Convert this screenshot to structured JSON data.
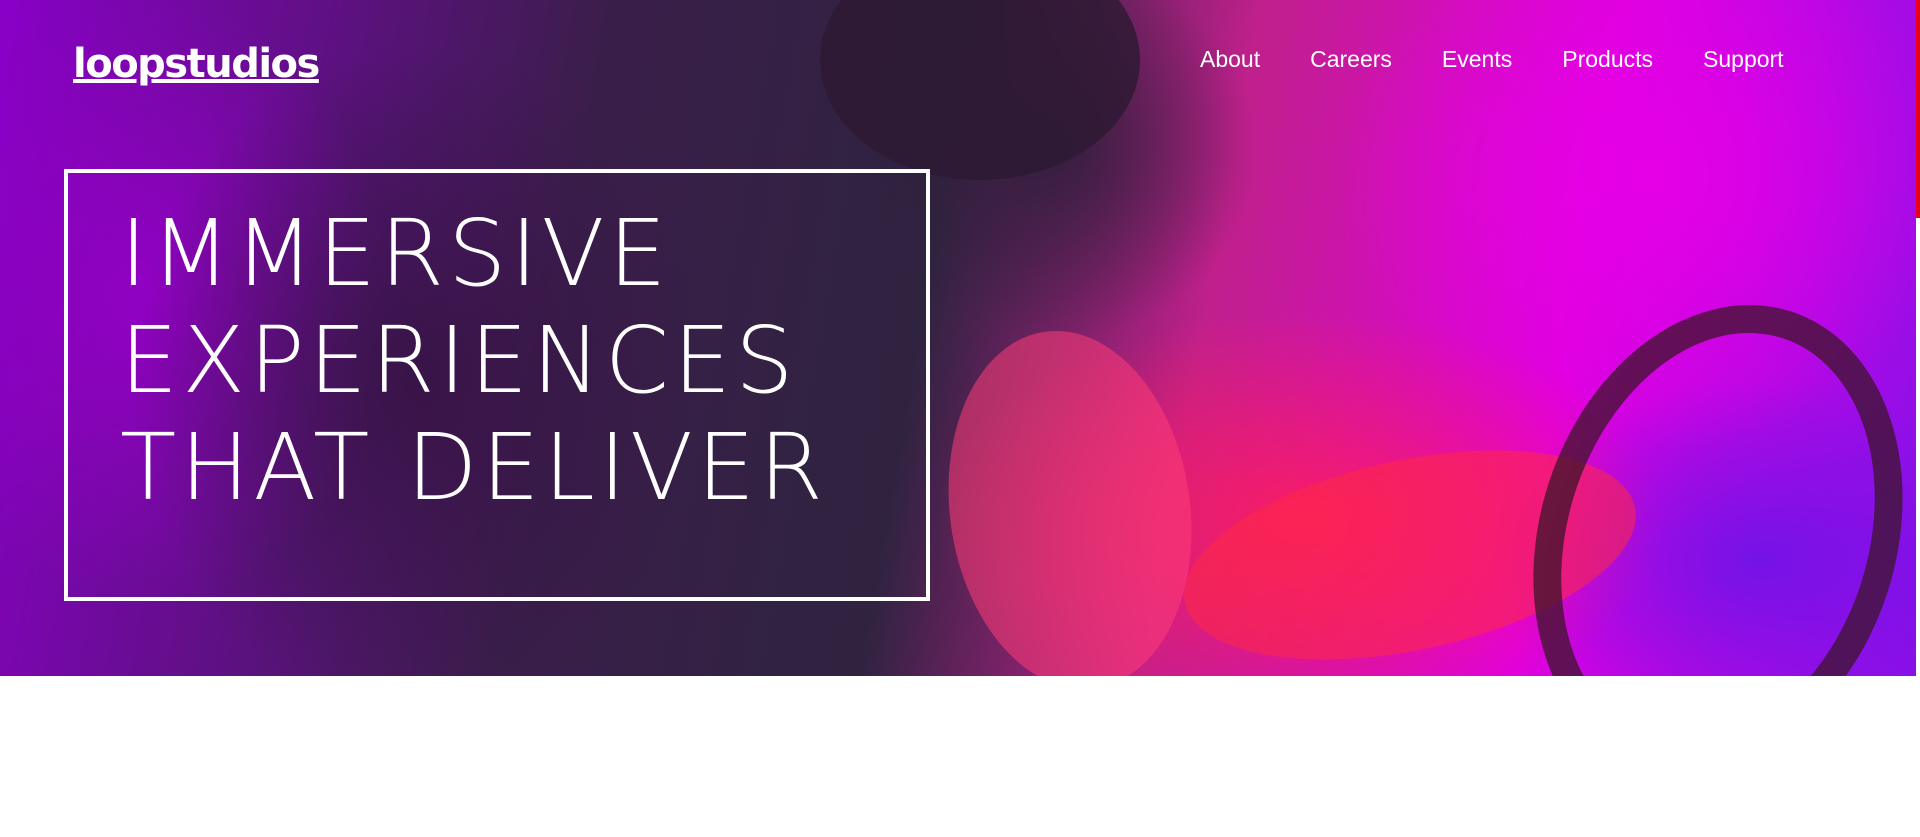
{
  "brand": {
    "logo_text": "loopstudios"
  },
  "nav": {
    "items": [
      {
        "label": "About"
      },
      {
        "label": "Careers"
      },
      {
        "label": "Events"
      },
      {
        "label": "Products"
      },
      {
        "label": "Support"
      }
    ]
  },
  "hero": {
    "title_lines": [
      "IMMERSIVE",
      "EXPERIENCES",
      "THAT DELIVER"
    ]
  },
  "colors": {
    "text": "#ffffff",
    "accent_strip": "#e8001a",
    "page_background": "#ffffff"
  }
}
